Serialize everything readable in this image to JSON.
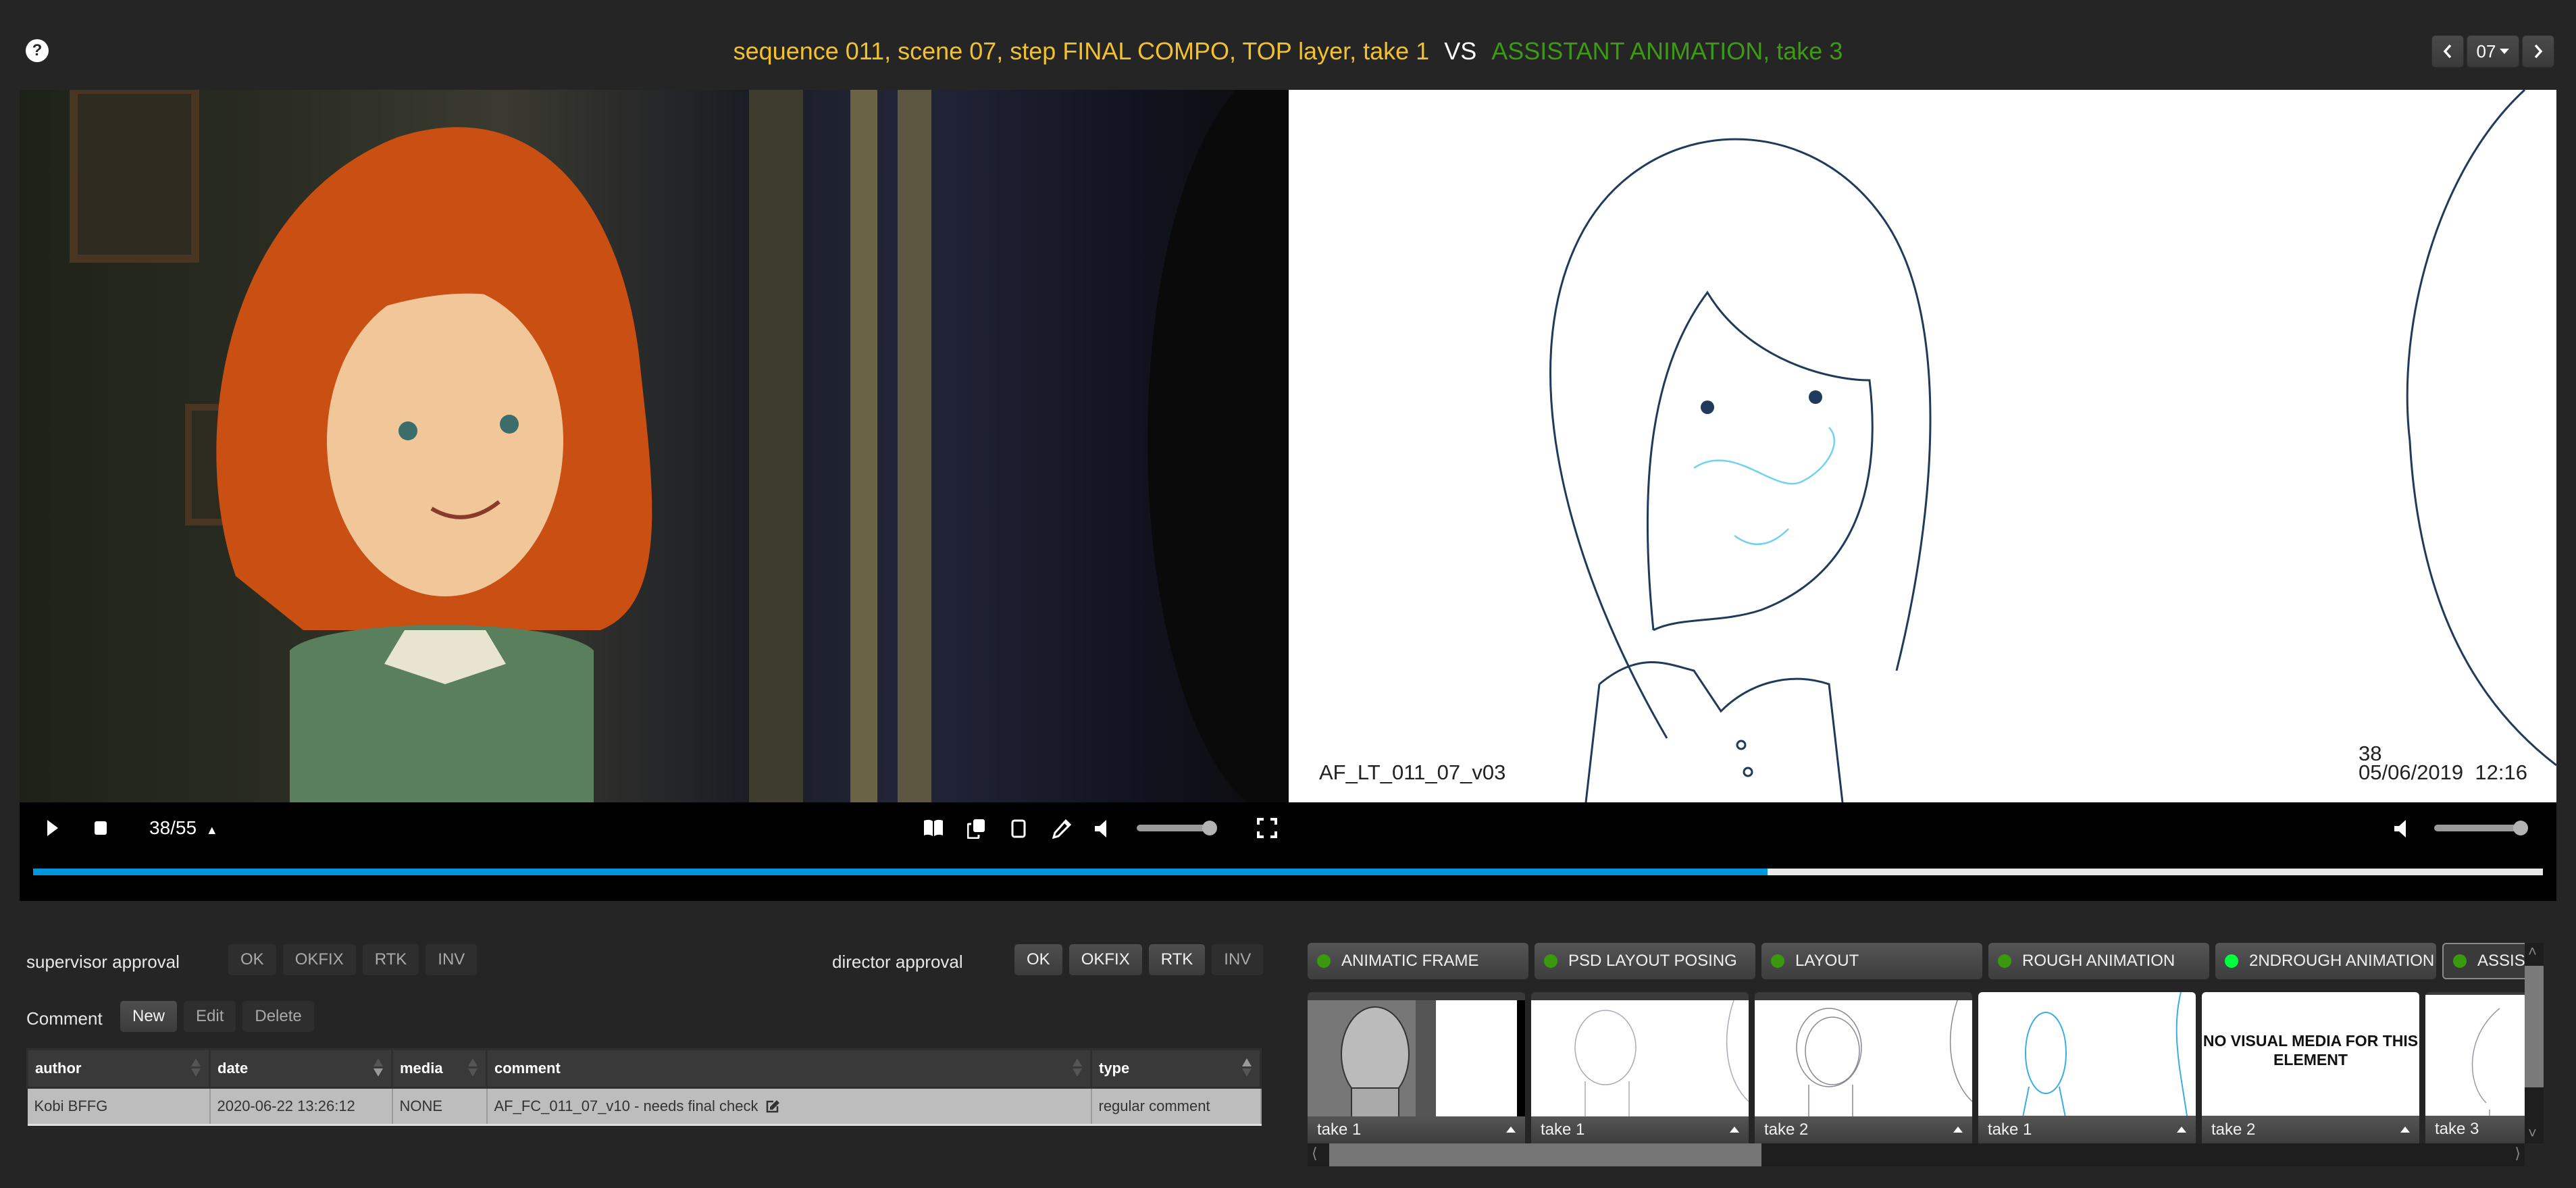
{
  "header": {
    "help_icon": "question-circle-icon",
    "title_left": "sequence 011, scene 07, step FINAL COMPO, TOP layer, take 1",
    "title_vs": "VS",
    "title_right": "ASSISTANT ANIMATION, take 3",
    "title_left_color": "#f2c12e",
    "title_right_color": "#3d9b13",
    "scene_nav": {
      "prev_icon": "chevron-left-icon",
      "current": "07",
      "next_icon": "chevron-right-icon"
    }
  },
  "viewers": {
    "right_overlay": {
      "file_label": "AF_LT_011_07_v03",
      "frame_number": "38",
      "timestamp": "05/06/2019  12:16"
    }
  },
  "player": {
    "play_icon": "play-icon",
    "stop_icon": "stop-icon",
    "frame_counter": "38/55",
    "current_frame": 38,
    "total_frames": 55,
    "progress_percent": 69.1,
    "left_volume_percent": 100,
    "right_volume_percent": 100,
    "tools": [
      "book-icon",
      "copy-icon",
      "square-icon",
      "pencil-icon",
      "volume-icon",
      "fullscreen-icon"
    ]
  },
  "approvals": {
    "supervisor": {
      "label": "supervisor approval",
      "buttons": [
        {
          "label": "OK",
          "active": false
        },
        {
          "label": "OKFIX",
          "active": false
        },
        {
          "label": "RTK",
          "active": false
        },
        {
          "label": "INV",
          "active": false
        }
      ]
    },
    "director": {
      "label": "director approval",
      "buttons": [
        {
          "label": "OK",
          "active": true
        },
        {
          "label": "OKFIX",
          "active": true
        },
        {
          "label": "RTK",
          "active": true
        },
        {
          "label": "INV",
          "active": false
        }
      ]
    }
  },
  "comment": {
    "label": "Comment",
    "new_label": "New",
    "edit_label": "Edit",
    "delete_label": "Delete",
    "table": {
      "columns": [
        "author",
        "date",
        "media",
        "comment",
        "type"
      ],
      "rows": [
        {
          "author": "Kobi BFFG",
          "date": "2020-06-22 13:26:12",
          "media": "NONE",
          "comment": "AF_FC_011_07_v10 - needs final check",
          "type": "regular comment"
        }
      ]
    }
  },
  "steps": {
    "tabs": [
      {
        "label": "ANIMATIC FRAME",
        "status_color": "#3a9a0e"
      },
      {
        "label": "PSD LAYOUT POSING",
        "status_color": "#3a9a0e"
      },
      {
        "label": "LAYOUT",
        "status_color": "#3a9a0e"
      },
      {
        "label": "ROUGH ANIMATION",
        "status_color": "#3a9a0e"
      },
      {
        "label": "2NDROUGH ANIMATION",
        "status_color": "#00ff3c"
      },
      {
        "label": "ASSISTANT ANIMATION",
        "status_color": "#3a9a0e"
      }
    ],
    "thumbnails": [
      {
        "take": "take 1"
      },
      {
        "take": "take 1"
      },
      {
        "take": "take 2"
      },
      {
        "take": "take 1"
      },
      {
        "take": "take 2",
        "no_media_text": "NO VISUAL MEDIA FOR THIS ELEMENT"
      },
      {
        "take": "take 3"
      }
    ]
  }
}
